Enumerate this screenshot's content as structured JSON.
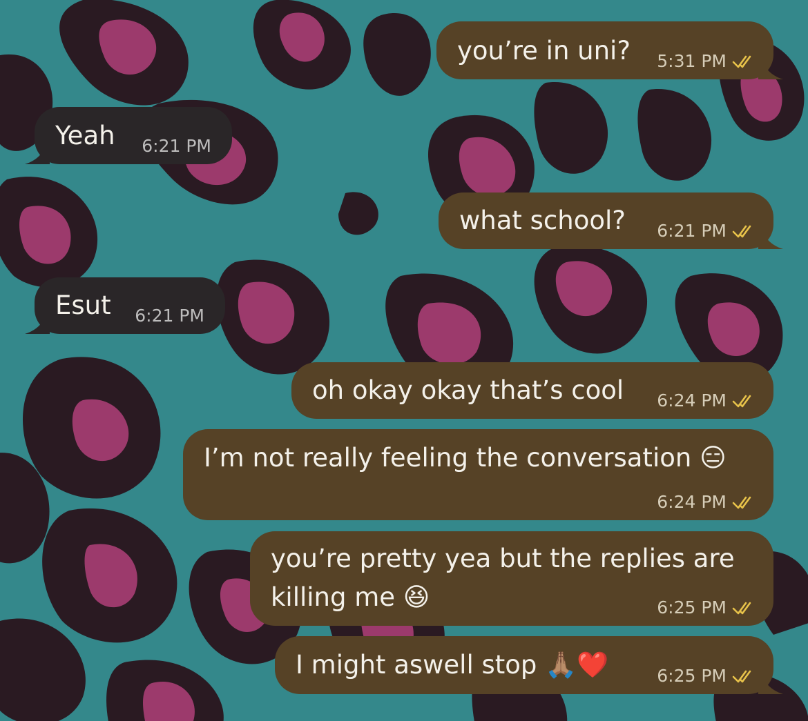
{
  "colors": {
    "background": "#34888b",
    "spot_dark": "#2a1a22",
    "spot_pink": "#9c3a6c",
    "outgoing_bubble": "#564226",
    "incoming_bubble": "#2a2628",
    "read_ticks": "#e8c34a"
  },
  "messages": [
    {
      "id": "m1",
      "direction": "outgoing",
      "text": "you’re in uni?",
      "time": "5:31 PM",
      "status": "read"
    },
    {
      "id": "m2",
      "direction": "incoming",
      "text": "Yeah",
      "time": "6:21 PM"
    },
    {
      "id": "m3",
      "direction": "outgoing",
      "text": "what school?",
      "time": "6:21 PM",
      "status": "read"
    },
    {
      "id": "m4",
      "direction": "incoming",
      "text": "Esut",
      "time": "6:21 PM"
    },
    {
      "id": "m5",
      "direction": "outgoing",
      "text": "oh okay okay that’s cool",
      "time": "6:24 PM",
      "status": "read"
    },
    {
      "id": "m6",
      "direction": "outgoing",
      "text": "I’m not really feeling the conversation 😑",
      "time": "6:24 PM",
      "status": "read"
    },
    {
      "id": "m7",
      "direction": "outgoing",
      "text_line1": "you’re pretty yea but the replies are",
      "text_line2": "killing me 😆",
      "time": "6:25 PM",
      "status": "read"
    },
    {
      "id": "m8",
      "direction": "outgoing",
      "text": "I might aswell stop 🙏🏽❤️",
      "time": "6:25 PM",
      "status": "read"
    }
  ],
  "icons": {
    "read_status": "double-check-icon"
  }
}
